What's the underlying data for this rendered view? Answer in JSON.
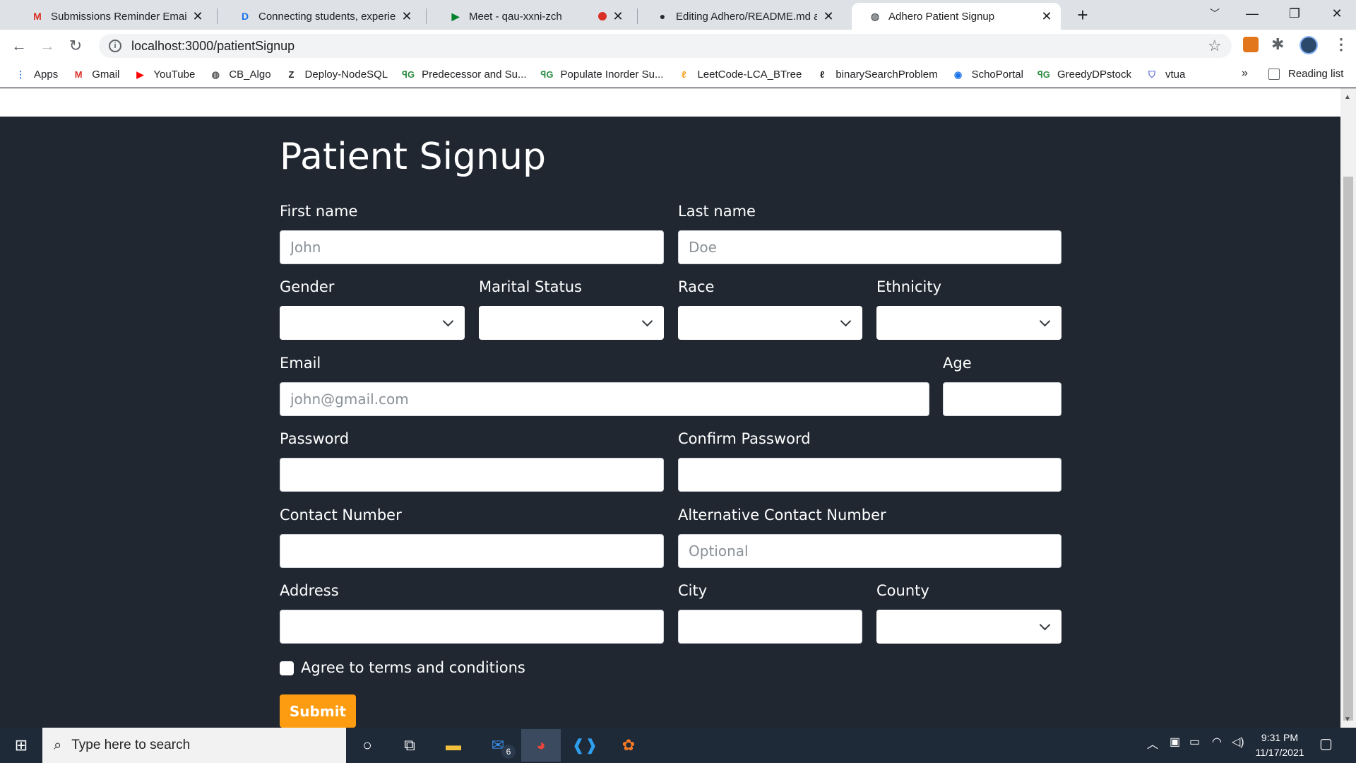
{
  "browser": {
    "tabs": [
      {
        "title": "Submissions Reminder Email Dra",
        "icon": "gmail-icon",
        "glyph": "M",
        "color": "#d93025"
      },
      {
        "title": "Connecting students, experience",
        "icon": "doc-icon",
        "glyph": "D",
        "color": "#1a73e8"
      },
      {
        "title": "Meet - qau-xxni-zch",
        "icon": "meet-icon",
        "glyph": "▶",
        "color": "#00832d"
      },
      {
        "title": "Editing Adhero/README.md at m",
        "icon": "github-icon",
        "glyph": "●",
        "color": "#24292e"
      },
      {
        "title": "Adhero Patient Signup",
        "icon": "globe-icon",
        "glyph": "◍",
        "color": "#5f6368"
      }
    ],
    "url": "localhost:3000/patientSignup",
    "bookmarks": [
      {
        "label": "Apps",
        "icon": "apps-grid-icon",
        "glyph": "⋮",
        "color": "#1a73e8"
      },
      {
        "label": "Gmail",
        "icon": "gmail-icon",
        "glyph": "M",
        "color": "#d93025"
      },
      {
        "label": "YouTube",
        "icon": "youtube-icon",
        "glyph": "▶",
        "color": "#ff0000"
      },
      {
        "label": "CB_Algo",
        "icon": "globe-icon",
        "glyph": "◍",
        "color": "#555"
      },
      {
        "label": "Deploy-NodeSQL",
        "icon": "z-icon",
        "glyph": "Z",
        "color": "#222"
      },
      {
        "label": "Predecessor and Su...",
        "icon": "gfg-icon",
        "glyph": "ꟼG",
        "color": "#2f8d46"
      },
      {
        "label": "Populate Inorder Su...",
        "icon": "gfg-icon",
        "glyph": "ꟼG",
        "color": "#2f8d46"
      },
      {
        "label": "LeetCode-LCA_BTree",
        "icon": "leetcode-icon",
        "glyph": "ℓ",
        "color": "#f89f1b"
      },
      {
        "label": "binarySearchProblem",
        "icon": "leetcode-icon",
        "glyph": "ℓ",
        "color": "#222"
      },
      {
        "label": "SchoPortal",
        "icon": "portal-icon",
        "glyph": "◉",
        "color": "#1a73e8"
      },
      {
        "label": "GreedyDPstock",
        "icon": "gfg-icon",
        "glyph": "ꟼG",
        "color": "#2f8d46"
      },
      {
        "label": "vtua",
        "icon": "shield-icon",
        "glyph": "⛉",
        "color": "#5f6ad8"
      }
    ],
    "reading_list": "Reading list",
    "more": "»"
  },
  "form": {
    "title": "Patient Signup",
    "first_name": {
      "label": "First name",
      "placeholder": "John"
    },
    "last_name": {
      "label": "Last name",
      "placeholder": "Doe"
    },
    "gender": {
      "label": "Gender"
    },
    "marital": {
      "label": "Marital Status"
    },
    "race": {
      "label": "Race"
    },
    "ethnicity": {
      "label": "Ethnicity"
    },
    "email": {
      "label": "Email",
      "placeholder": "john@gmail.com"
    },
    "age": {
      "label": "Age"
    },
    "password": {
      "label": "Password"
    },
    "confirm": {
      "label": "Confirm Password"
    },
    "contact": {
      "label": "Contact Number"
    },
    "alt_contact": {
      "label": "Alternative Contact Number",
      "placeholder": "Optional"
    },
    "address": {
      "label": "Address"
    },
    "city": {
      "label": "City"
    },
    "county": {
      "label": "County"
    },
    "terms": "Agree to terms and conditions",
    "submit": "Submit"
  },
  "taskbar": {
    "search_placeholder": "Type here to search",
    "mail_badge": "6",
    "time": "9:31 PM",
    "date": "11/17/2021"
  },
  "colors": {
    "page_bg": "#202731",
    "submit": "#fd9c10",
    "taskbar": "#1f2a39"
  }
}
